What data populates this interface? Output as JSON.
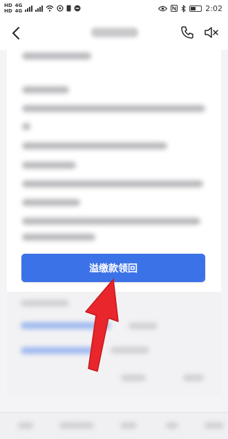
{
  "status_bar": {
    "time": "2:02",
    "sim1": "HD",
    "sim2": "HD",
    "net1": "4G",
    "net2": "4G"
  },
  "header": {
    "title": "",
    "icons": [
      "back-icon",
      "phone-icon",
      "mute-icon"
    ]
  },
  "main": {
    "action_button_label": "溢缴款领回"
  },
  "colors": {
    "accent": "#3c72e7",
    "arrow": "#e8262b",
    "background": "#f4f4f6"
  }
}
